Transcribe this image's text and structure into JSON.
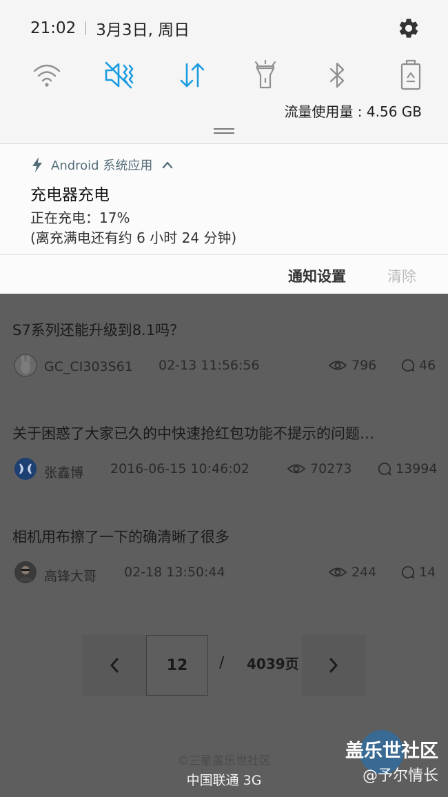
{
  "status_bar": {
    "time": "21:02",
    "date": "3月3日, 周日",
    "settings_icon": "gear-icon"
  },
  "quick_settings": {
    "toggles": [
      {
        "icon": "wifi-icon",
        "state": "off"
      },
      {
        "icon": "sound-muted-vibrate-icon",
        "state": "on"
      },
      {
        "icon": "mobile-data-icon",
        "state": "on"
      },
      {
        "icon": "flashlight-icon",
        "state": "off"
      },
      {
        "icon": "bluetooth-icon",
        "state": "off"
      },
      {
        "icon": "power-saving-icon",
        "state": "off"
      }
    ],
    "active_color": "#1a9be0",
    "inactive_color": "#8f8f8f",
    "data_usage": "流量使用量 : 4.56 GB"
  },
  "notification": {
    "app_name": "Android 系统应用",
    "app_icon": "lightning-icon",
    "title": "充电器充电",
    "line1": "正在充电：17%",
    "line2": "(离充满电还有约 6 小时 24 分钟)",
    "settings_label": "通知设置",
    "clear_label": "清除"
  },
  "forum": {
    "posts": [
      {
        "title": "S7系列还能升级到8.1吗？",
        "author": "GC_CI303S61",
        "time": "02-13 11:56:56",
        "views": "796",
        "replies": "46"
      },
      {
        "title": "关于困惑了大家已久的中快速抢红包功能不提示的问题…",
        "author": "张鑫博",
        "time": "2016-06-15 10:46:02",
        "views": "70273",
        "replies": "13994"
      },
      {
        "title": "相机用布擦了一下的确清晰了很多",
        "author": "高锋大哥",
        "time": "02-18 13:50:44",
        "views": "244",
        "replies": "14"
      }
    ],
    "pager": {
      "current": "12",
      "separator": "/",
      "total": "4039页"
    },
    "copyright": "©三星盖乐世社区",
    "carrier": "中国联通 3G"
  },
  "watermark": {
    "title": "盖乐世社区",
    "subtitle": "@予尔情长"
  }
}
